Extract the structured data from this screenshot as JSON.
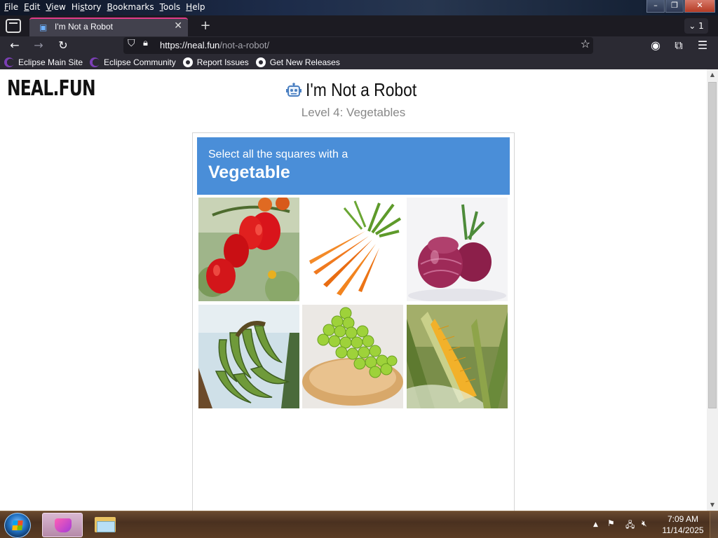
{
  "browser": {
    "menu": [
      "File",
      "Edit",
      "View",
      "History",
      "Bookmarks",
      "Tools",
      "Help"
    ],
    "menu_mnemonics": [
      "F",
      "E",
      "V",
      "s",
      "B",
      "T",
      "H"
    ],
    "window_controls": {
      "minimize": "–",
      "maximize": "❐",
      "close": "✕"
    },
    "tab": {
      "title": "I'm Not a Robot",
      "close": "✕"
    },
    "new_tab": "+",
    "tab_list": {
      "label": "1"
    },
    "nav": {
      "back": "←",
      "forward": "→",
      "reload": "↻"
    },
    "url": {
      "host": "https://neal.fun",
      "path": "/not-a-robot/"
    },
    "bookmarks": [
      {
        "label": "Eclipse Main Site",
        "icon": "eclipse-icon"
      },
      {
        "label": "Eclipse Community",
        "icon": "eclipse-icon"
      },
      {
        "label": "Report Issues",
        "icon": "github-icon"
      },
      {
        "label": "Get New Releases",
        "icon": "github-icon"
      }
    ]
  },
  "page": {
    "logo": "NEAL.FUN",
    "title": "I'm Not a Robot",
    "level": "Level 4: Vegetables",
    "captcha": {
      "instruction": "Select all the squares with a",
      "target": "Vegetable",
      "tiles": [
        {
          "name": "tomatoes",
          "selected": false
        },
        {
          "name": "carrots",
          "selected": false
        },
        {
          "name": "red-onions",
          "selected": false
        },
        {
          "name": "bananas",
          "selected": false
        },
        {
          "name": "grapes",
          "selected": false
        },
        {
          "name": "corn",
          "selected": false
        }
      ]
    }
  },
  "taskbar": {
    "clock_time": "7:09 AM",
    "clock_date": "11/14/2025"
  },
  "colors": {
    "captcha_header": "#4a8ed8",
    "tab_accent": "#e23a8a",
    "toolbar": "#2b2a33"
  }
}
